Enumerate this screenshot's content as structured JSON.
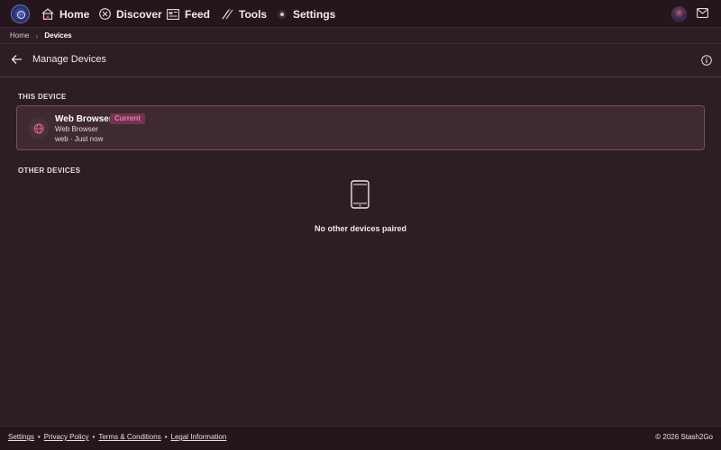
{
  "nav": {
    "items": [
      {
        "label": "Home",
        "icon": "home-icon"
      },
      {
        "label": "Discover",
        "icon": "discover-icon"
      },
      {
        "label": "Feed",
        "icon": "feed-icon"
      },
      {
        "label": "Tools",
        "icon": "tools-icon"
      },
      {
        "label": "Settings",
        "icon": "settings-icon"
      }
    ]
  },
  "breadcrumb": {
    "home": "Home",
    "current": "Devices"
  },
  "page": {
    "title": "Manage Devices"
  },
  "this_device": {
    "section_label": "THIS DEVICE",
    "name": "Web Browser",
    "badge": "Current",
    "type": "Web Browser",
    "meta": "web · Just now"
  },
  "other_devices": {
    "section_label": "OTHER DEVICES",
    "empty_text": "No other devices paired"
  },
  "footer": {
    "links": [
      "Settings",
      "Privacy Policy",
      "Terms & Conditions",
      "Legal Information"
    ],
    "separator": "•",
    "copyright": "© 2026 Stash2Go"
  },
  "colors": {
    "background": "#2c1e24",
    "nav_background": "#24161c",
    "card_background": "#3e2a30",
    "accent": "#f07bb0"
  }
}
